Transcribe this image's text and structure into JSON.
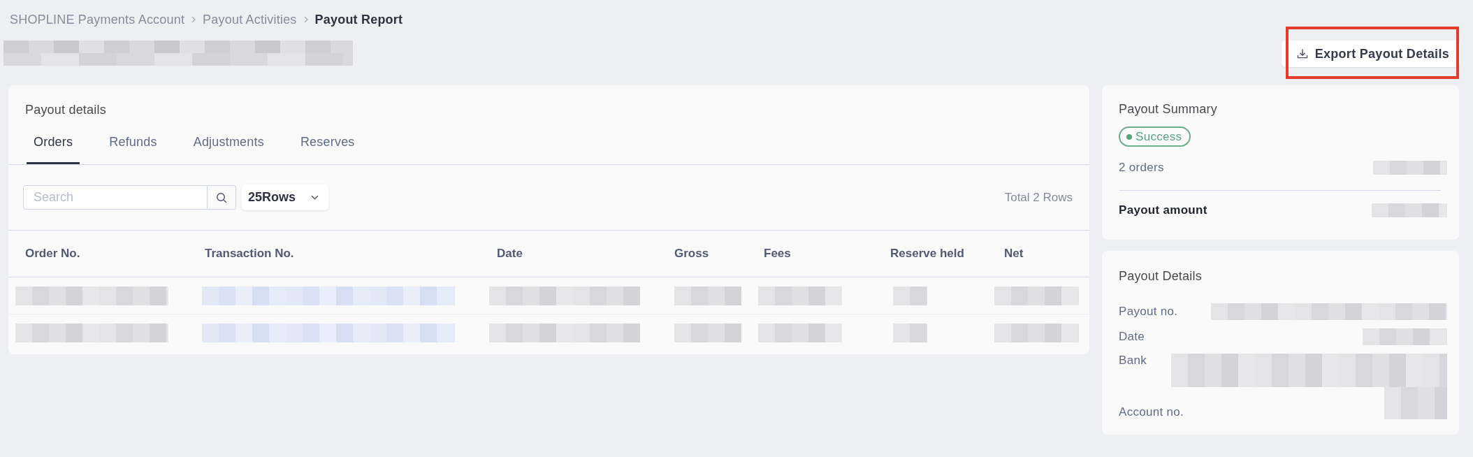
{
  "breadcrumb": [
    {
      "label": "SHOPLINE Payments Account",
      "current": false
    },
    {
      "label": "Payout Activities",
      "current": false
    },
    {
      "label": "Payout Report",
      "current": true
    }
  ],
  "page_title": {
    "kind": "redacted"
  },
  "export_button": {
    "label": "Export Payout Details",
    "highlighted": true
  },
  "payout_details": {
    "title": "Payout details",
    "tabs": [
      {
        "label": "Orders",
        "selected": true
      },
      {
        "label": "Refunds",
        "selected": false
      },
      {
        "label": "Adjustments",
        "selected": false
      },
      {
        "label": "Reserves",
        "selected": false
      }
    ],
    "search": {
      "placeholder": "Search"
    },
    "rows_select": {
      "value": "25Rows"
    },
    "total": "Total 2 Rows",
    "table": {
      "columns": [
        "Order No.",
        "Transaction No.",
        "Date",
        "Gross",
        "Fees",
        "Reserve held",
        "Net"
      ],
      "rows": [
        {
          "cells": [
            {
              "kind": "redacted"
            },
            {
              "kind": "redacted-link"
            },
            {
              "kind": "redacted"
            },
            {
              "kind": "redacted"
            },
            {
              "kind": "redacted"
            },
            {
              "kind": "redacted"
            },
            {
              "kind": "redacted"
            }
          ]
        },
        {
          "cells": [
            {
              "kind": "redacted"
            },
            {
              "kind": "redacted-link"
            },
            {
              "kind": "redacted"
            },
            {
              "kind": "redacted"
            },
            {
              "kind": "redacted"
            },
            {
              "kind": "redacted"
            },
            {
              "kind": "redacted"
            }
          ]
        }
      ]
    }
  },
  "payout_summary": {
    "title": "Payout Summary",
    "status": {
      "label": "Success",
      "kind": "success"
    },
    "lines": [
      {
        "label": "2 orders",
        "emphasis": false,
        "value": {
          "kind": "redacted"
        }
      },
      {
        "label": "Payout amount",
        "emphasis": true,
        "value": {
          "kind": "redacted"
        }
      }
    ]
  },
  "payout_details_card": {
    "title": "Payout Details",
    "fields": [
      {
        "label": "Payout no.",
        "value": {
          "kind": "redacted"
        }
      },
      {
        "label": "Date",
        "value": {
          "kind": "redacted"
        }
      },
      {
        "label": "Bank",
        "value": {
          "kind": "redacted"
        }
      },
      {
        "label": "Account no.",
        "value": {
          "kind": "redacted"
        }
      }
    ]
  }
}
